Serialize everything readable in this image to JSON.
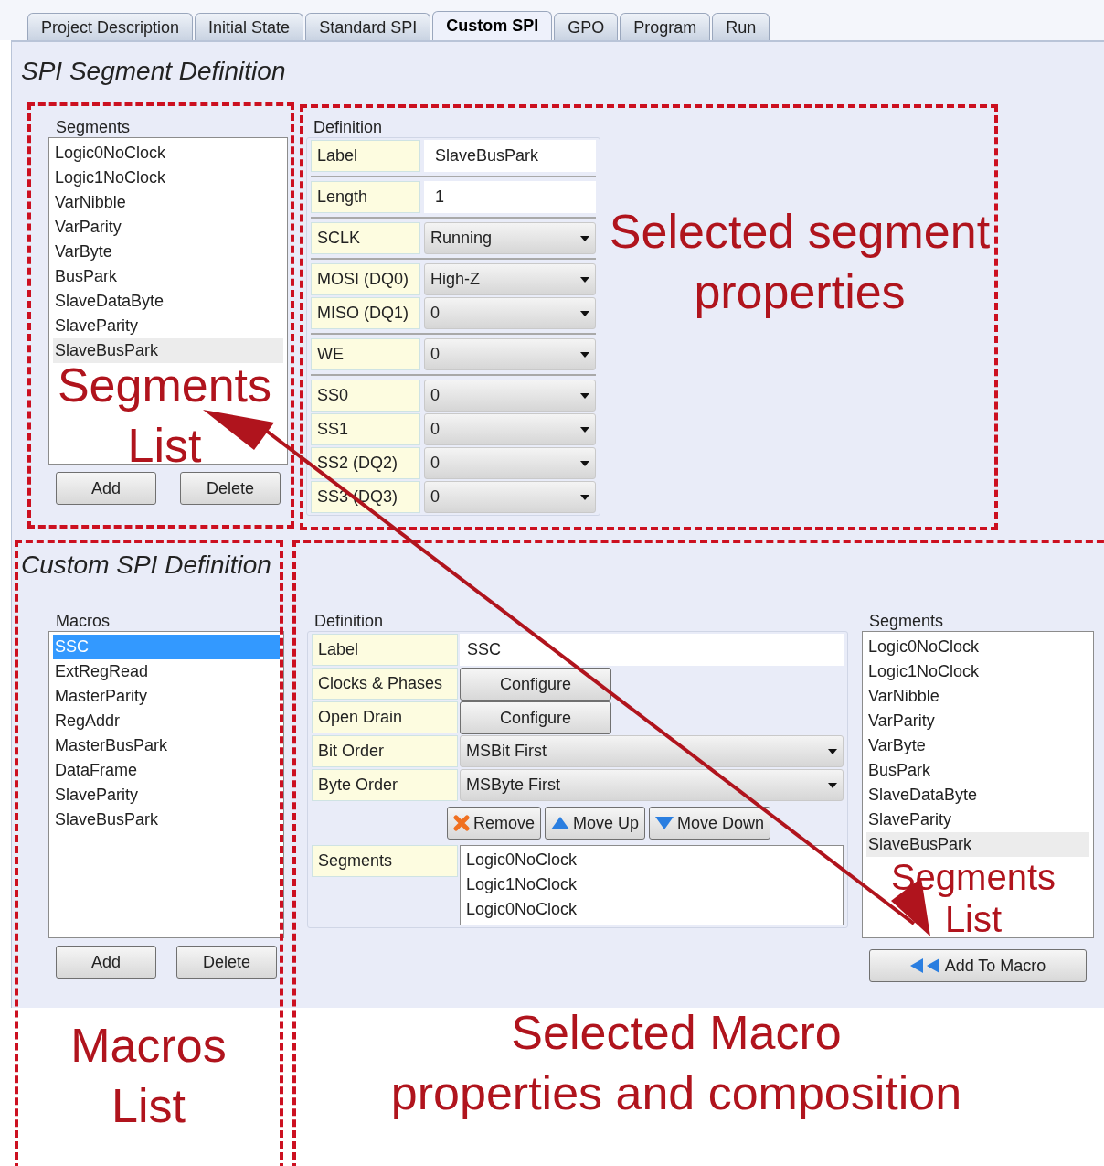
{
  "tabs": [
    {
      "label": "Project Description",
      "selected": false
    },
    {
      "label": "Initial State",
      "selected": false
    },
    {
      "label": "Standard SPI",
      "selected": false
    },
    {
      "label": "Custom SPI",
      "selected": true
    },
    {
      "label": "GPO",
      "selected": false
    },
    {
      "label": "Program",
      "selected": false
    },
    {
      "label": "Run",
      "selected": false
    }
  ],
  "segment_section": {
    "title": "SPI Segment Definition",
    "segments": {
      "heading": "Segments",
      "items": [
        {
          "label": "Logic0NoClock",
          "selected": false
        },
        {
          "label": "Logic1NoClock",
          "selected": false
        },
        {
          "label": "VarNibble",
          "selected": false
        },
        {
          "label": "VarParity",
          "selected": false
        },
        {
          "label": "VarByte",
          "selected": false
        },
        {
          "label": "BusPark",
          "selected": false
        },
        {
          "label": "SlaveDataByte",
          "selected": false
        },
        {
          "label": "SlaveParity",
          "selected": false
        },
        {
          "label": "SlaveBusPark",
          "selected": true
        }
      ],
      "buttons": [
        "Add",
        "Delete"
      ]
    },
    "definition": {
      "heading": "Definition",
      "groups": [
        [
          {
            "label": "Label",
            "kind": "text",
            "value": "SlaveBusPark"
          }
        ],
        [
          {
            "label": "Length",
            "kind": "text",
            "value": "1"
          }
        ],
        [
          {
            "label": "SCLK",
            "kind": "dropdown",
            "value": "Running"
          }
        ],
        [
          {
            "label": "MOSI (DQ0)",
            "kind": "dropdown",
            "value": "High-Z"
          },
          {
            "label": "MISO (DQ1)",
            "kind": "dropdown",
            "value": "0"
          }
        ],
        [
          {
            "label": "WE",
            "kind": "dropdown",
            "value": "0"
          }
        ],
        [
          {
            "label": "SS0",
            "kind": "dropdown",
            "value": "0"
          },
          {
            "label": "SS1",
            "kind": "dropdown",
            "value": "0"
          },
          {
            "label": "SS2 (DQ2)",
            "kind": "dropdown",
            "value": "0"
          },
          {
            "label": "SS3 (DQ3)",
            "kind": "dropdown",
            "value": "0"
          }
        ]
      ]
    }
  },
  "macro_section": {
    "title": "Custom SPI Definition",
    "macros": {
      "heading": "Macros",
      "items": [
        {
          "label": "SSC",
          "selected": true
        },
        {
          "label": "ExtRegRead",
          "selected": false
        },
        {
          "label": "MasterParity",
          "selected": false
        },
        {
          "label": "RegAddr",
          "selected": false
        },
        {
          "label": "MasterBusPark",
          "selected": false
        },
        {
          "label": "DataFrame",
          "selected": false
        },
        {
          "label": "SlaveParity",
          "selected": false
        },
        {
          "label": "SlaveBusPark",
          "selected": false
        }
      ],
      "buttons": [
        "Add",
        "Delete"
      ]
    },
    "definition": {
      "heading": "Definition",
      "rows": [
        {
          "label": "Label",
          "kind": "text",
          "value": "SSC"
        },
        {
          "label": "Clocks & Phases",
          "kind": "button",
          "value": "Configure"
        },
        {
          "label": "Open Drain",
          "kind": "button",
          "value": "Configure"
        },
        {
          "label": "Bit Order",
          "kind": "dropdown",
          "value": "MSBit First"
        },
        {
          "label": "Byte Order",
          "kind": "dropdown",
          "value": "MSByte First"
        }
      ],
      "actions": [
        {
          "kind": "remove",
          "label": "Remove"
        },
        {
          "kind": "up",
          "label": "Move Up"
        },
        {
          "kind": "down",
          "label": "Move Down"
        }
      ],
      "segments_label": "Segments",
      "segments": [
        "Logic0NoClock",
        "Logic1NoClock",
        "Logic0NoClock"
      ]
    },
    "segments": {
      "heading": "Segments",
      "items": [
        {
          "label": "Logic0NoClock",
          "selected": false
        },
        {
          "label": "Logic1NoClock",
          "selected": false
        },
        {
          "label": "VarNibble",
          "selected": false
        },
        {
          "label": "VarParity",
          "selected": false
        },
        {
          "label": "VarByte",
          "selected": false
        },
        {
          "label": "BusPark",
          "selected": false
        },
        {
          "label": "SlaveDataByte",
          "selected": false
        },
        {
          "label": "SlaveParity",
          "selected": false
        },
        {
          "label": "SlaveBusPark",
          "selected": true
        }
      ],
      "button": "Add To Macro"
    }
  },
  "annotations": [
    {
      "lines": [
        "Selected segment",
        "properties"
      ]
    },
    {
      "lines": [
        "Segments",
        "List"
      ]
    },
    {
      "lines": [
        "Segments",
        "List"
      ]
    },
    {
      "lines": [
        "Macros",
        "List"
      ]
    },
    {
      "lines": [
        "Selected Macro",
        "properties and composition"
      ]
    }
  ]
}
